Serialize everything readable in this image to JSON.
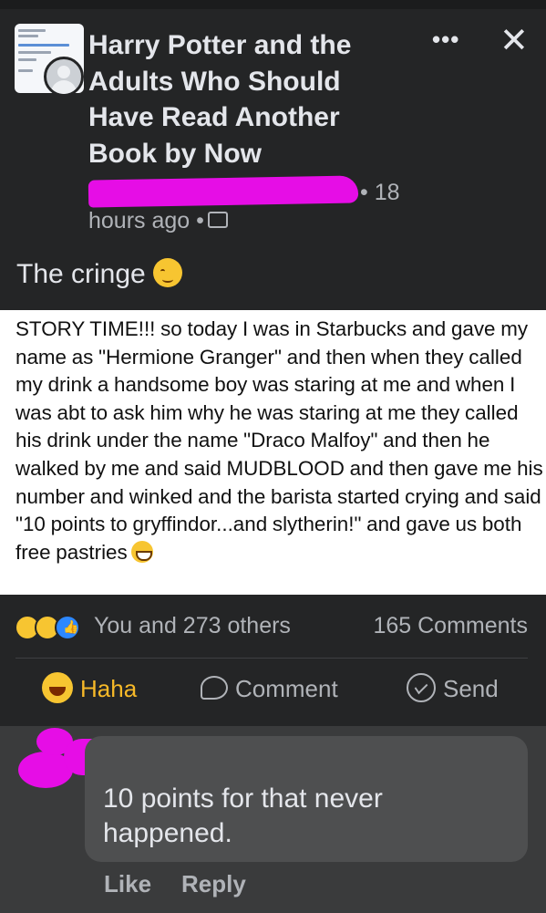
{
  "header": {
    "group_title": "Harry Potter and the Adults Who Should Have Read Another Book by Now",
    "time_number": "18",
    "time_rest": "hours ago •",
    "more_icon": "more-dots-icon",
    "close_icon": "close-icon",
    "privacy_icon": "group-members-icon"
  },
  "post": {
    "text": "The cringe",
    "emoji": "woozy-face-icon",
    "screenshot_text": "STORY TIME!!! so today I was in Starbucks and gave my name as \"Hermione Granger\" and then when they called my drink a handsome boy was staring at me and when I was abt to ask him why he was staring at me they called his drink under the name \"Draco Malfoy\" and then he walked by me and said MUDBLOOD and then gave me his number and winked and the barista started crying and said \"10 points to gryffindor...and slytherin!\" and gave us both free pastries"
  },
  "engagement": {
    "reactions_text": "You and 273 others",
    "comments_text": "165 Comments",
    "reaction_icons": [
      "haha-icon",
      "sad-icon",
      "like-icon"
    ]
  },
  "actions": {
    "haha_label": "Haha",
    "comment_label": "Comment",
    "send_label": "Send"
  },
  "comment": {
    "text": "10 points for that never happened.",
    "like_label": "Like",
    "reply_label": "Reply"
  },
  "colors": {
    "background": "#242526",
    "card": "#ffffff",
    "redaction": "#e60de6",
    "haha_accent": "#f7b928",
    "like_blue": "#2d88ff"
  }
}
